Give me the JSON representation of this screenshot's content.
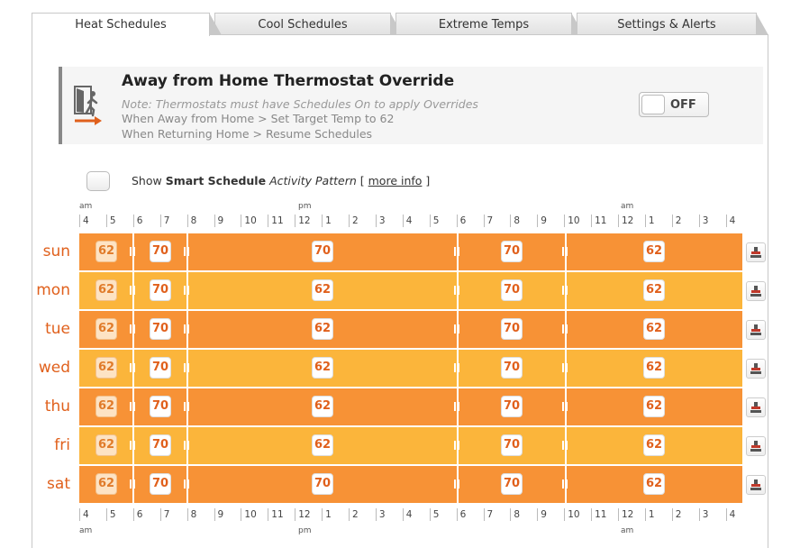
{
  "tabs": [
    {
      "label": "Heat Schedules",
      "active": true
    },
    {
      "label": "Cool Schedules",
      "active": false
    },
    {
      "label": "Extreme Temps",
      "active": false
    },
    {
      "label": "Settings & Alerts",
      "active": false
    }
  ],
  "away": {
    "title": "Away from Home Thermostat Override",
    "note": "Note: Thermostats must have Schedules On to apply Overrides",
    "line1": "When Away from Home > Set Target Temp to 62",
    "line2": "When Returning Home > Resume Schedules",
    "toggle_label": "OFF"
  },
  "smart": {
    "show": "Show",
    "bold": "Smart Schedule",
    "italic": "Activity Pattern",
    "more_info": "more info",
    "open_bracket": "[",
    "close_bracket": "]"
  },
  "axis": {
    "labels": [
      "4",
      "5",
      "6",
      "7",
      "8",
      "9",
      "10",
      "11",
      "12",
      "1",
      "2",
      "3",
      "4",
      "5",
      "6",
      "7",
      "8",
      "9",
      "10",
      "11",
      "12",
      "1",
      "2",
      "3",
      "4"
    ],
    "am1": "am",
    "pm": "pm",
    "am2": "am"
  },
  "colors": {
    "orange_dark": "#f79236",
    "orange_light": "#fbb53b",
    "day_text": "#e0601c"
  },
  "schedule": [
    {
      "day": "sun",
      "shade": "dark",
      "temps": [
        "62",
        "70",
        "70",
        "70",
        "62"
      ]
    },
    {
      "day": "mon",
      "shade": "light",
      "temps": [
        "62",
        "70",
        "62",
        "70",
        "62"
      ]
    },
    {
      "day": "tue",
      "shade": "dark",
      "temps": [
        "62",
        "70",
        "62",
        "70",
        "62"
      ]
    },
    {
      "day": "wed",
      "shade": "light",
      "temps": [
        "62",
        "70",
        "62",
        "70",
        "62"
      ]
    },
    {
      "day": "thu",
      "shade": "dark",
      "temps": [
        "62",
        "70",
        "62",
        "70",
        "62"
      ]
    },
    {
      "day": "fri",
      "shade": "light",
      "temps": [
        "62",
        "70",
        "62",
        "70",
        "62"
      ]
    },
    {
      "day": "sat",
      "shade": "dark",
      "temps": [
        "62",
        "70",
        "70",
        "70",
        "62"
      ]
    }
  ]
}
